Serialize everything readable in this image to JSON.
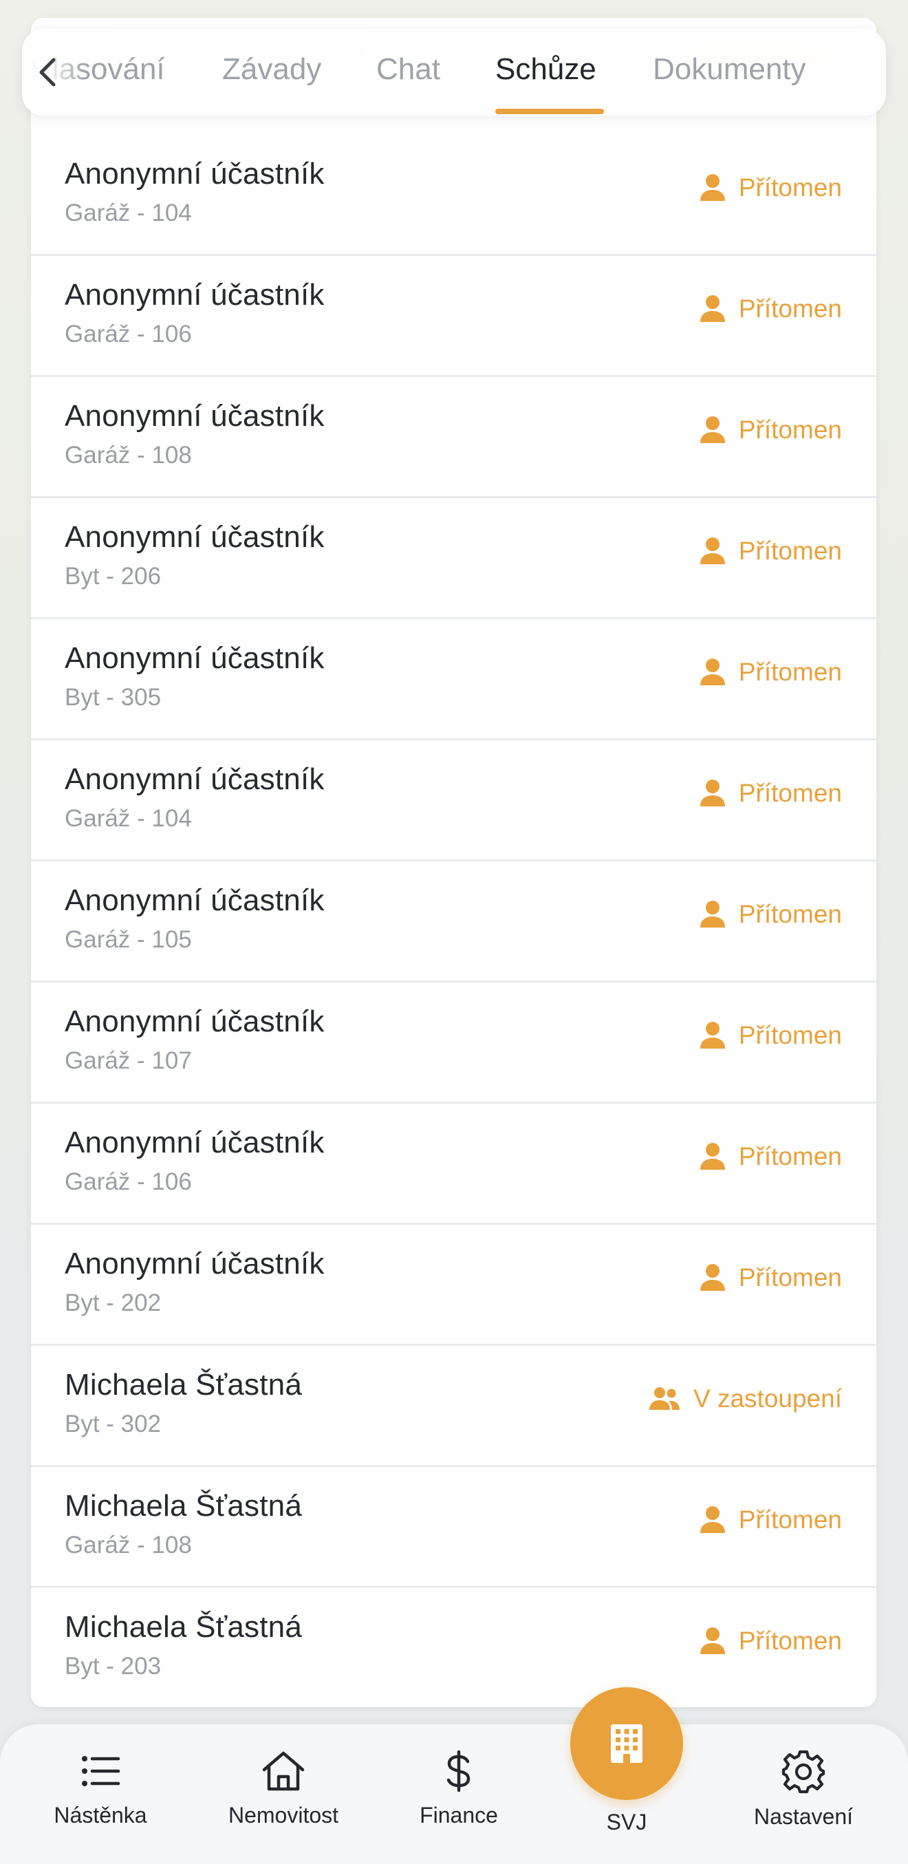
{
  "tabs": [
    {
      "label": "Hlasování",
      "active": false
    },
    {
      "label": "Závady",
      "active": false
    },
    {
      "label": "Chat",
      "active": false
    },
    {
      "label": "Schůze",
      "active": true
    },
    {
      "label": "Dokumenty",
      "active": false
    }
  ],
  "participants": [
    {
      "name": "Anonymní účastník",
      "unit": "Garáž - 104",
      "status": "Přítomen",
      "status_icon": "person-icon"
    },
    {
      "name": "Anonymní účastník",
      "unit": "Garáž - 106",
      "status": "Přítomen",
      "status_icon": "person-icon"
    },
    {
      "name": "Anonymní účastník",
      "unit": "Garáž - 108",
      "status": "Přítomen",
      "status_icon": "person-icon"
    },
    {
      "name": "Anonymní účastník",
      "unit": "Byt - 206",
      "status": "Přítomen",
      "status_icon": "person-icon"
    },
    {
      "name": "Anonymní účastník",
      "unit": "Byt - 305",
      "status": "Přítomen",
      "status_icon": "person-icon"
    },
    {
      "name": "Anonymní účastník",
      "unit": "Garáž - 104",
      "status": "Přítomen",
      "status_icon": "person-icon"
    },
    {
      "name": "Anonymní účastník",
      "unit": "Garáž - 105",
      "status": "Přítomen",
      "status_icon": "person-icon"
    },
    {
      "name": "Anonymní účastník",
      "unit": "Garáž - 107",
      "status": "Přítomen",
      "status_icon": "person-icon"
    },
    {
      "name": "Anonymní účastník",
      "unit": "Garáž - 106",
      "status": "Přítomen",
      "status_icon": "person-icon"
    },
    {
      "name": "Anonymní účastník",
      "unit": "Byt - 202",
      "status": "Přítomen",
      "status_icon": "person-icon"
    },
    {
      "name": "Michaela Šťastná",
      "unit": "Byt - 302",
      "status": "V zastoupení",
      "status_icon": "group-icon"
    },
    {
      "name": "Michaela Šťastná",
      "unit": "Garáž - 108",
      "status": "Přítomen",
      "status_icon": "person-icon"
    },
    {
      "name": "Michaela Šťastná",
      "unit": "Byt - 203",
      "status": "Přítomen",
      "status_icon": "person-icon"
    }
  ],
  "bottom_nav": {
    "items": [
      {
        "label": "Nástěnka",
        "icon": "list-icon"
      },
      {
        "label": "Nemovitost",
        "icon": "home-icon"
      },
      {
        "label": "Finance",
        "icon": "dollar-icon"
      },
      {
        "label": "SVJ",
        "icon": "building-icon",
        "active": true
      },
      {
        "label": "Nastavení",
        "icon": "gear-icon"
      }
    ]
  },
  "colors": {
    "accent": "#e9a13b",
    "text_primary": "#262a30",
    "text_secondary": "#9a9ea4",
    "tab_inactive": "#9ea2a8",
    "divider": "#e9ebee"
  }
}
